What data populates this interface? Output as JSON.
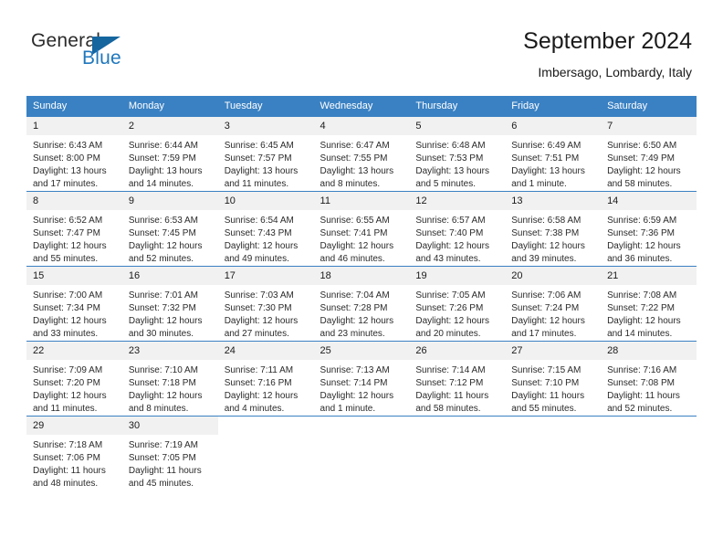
{
  "logo": {
    "word_one": "General",
    "word_two": "Blue",
    "triangle_icon": "triangle-right-icon",
    "brand_color": "#1f77bd",
    "triangle_color": "#15659f"
  },
  "header": {
    "title": "September 2024",
    "subtitle": "Imbersago, Lombardy, Italy",
    "header_bg_color": "#3a81c3",
    "daynum_bg_color": "#f1f1f1"
  },
  "weekday_headers": [
    "Sunday",
    "Monday",
    "Tuesday",
    "Wednesday",
    "Thursday",
    "Friday",
    "Saturday"
  ],
  "weeks": [
    [
      {
        "day": "1",
        "sunrise": "Sunrise: 6:43 AM",
        "sunset": "Sunset: 8:00 PM",
        "daylight_line1": "Daylight: 13 hours",
        "daylight_line2": "and 17 minutes."
      },
      {
        "day": "2",
        "sunrise": "Sunrise: 6:44 AM",
        "sunset": "Sunset: 7:59 PM",
        "daylight_line1": "Daylight: 13 hours",
        "daylight_line2": "and 14 minutes."
      },
      {
        "day": "3",
        "sunrise": "Sunrise: 6:45 AM",
        "sunset": "Sunset: 7:57 PM",
        "daylight_line1": "Daylight: 13 hours",
        "daylight_line2": "and 11 minutes."
      },
      {
        "day": "4",
        "sunrise": "Sunrise: 6:47 AM",
        "sunset": "Sunset: 7:55 PM",
        "daylight_line1": "Daylight: 13 hours",
        "daylight_line2": "and 8 minutes."
      },
      {
        "day": "5",
        "sunrise": "Sunrise: 6:48 AM",
        "sunset": "Sunset: 7:53 PM",
        "daylight_line1": "Daylight: 13 hours",
        "daylight_line2": "and 5 minutes."
      },
      {
        "day": "6",
        "sunrise": "Sunrise: 6:49 AM",
        "sunset": "Sunset: 7:51 PM",
        "daylight_line1": "Daylight: 13 hours",
        "daylight_line2": "and 1 minute."
      },
      {
        "day": "7",
        "sunrise": "Sunrise: 6:50 AM",
        "sunset": "Sunset: 7:49 PM",
        "daylight_line1": "Daylight: 12 hours",
        "daylight_line2": "and 58 minutes."
      }
    ],
    [
      {
        "day": "8",
        "sunrise": "Sunrise: 6:52 AM",
        "sunset": "Sunset: 7:47 PM",
        "daylight_line1": "Daylight: 12 hours",
        "daylight_line2": "and 55 minutes."
      },
      {
        "day": "9",
        "sunrise": "Sunrise: 6:53 AM",
        "sunset": "Sunset: 7:45 PM",
        "daylight_line1": "Daylight: 12 hours",
        "daylight_line2": "and 52 minutes."
      },
      {
        "day": "10",
        "sunrise": "Sunrise: 6:54 AM",
        "sunset": "Sunset: 7:43 PM",
        "daylight_line1": "Daylight: 12 hours",
        "daylight_line2": "and 49 minutes."
      },
      {
        "day": "11",
        "sunrise": "Sunrise: 6:55 AM",
        "sunset": "Sunset: 7:41 PM",
        "daylight_line1": "Daylight: 12 hours",
        "daylight_line2": "and 46 minutes."
      },
      {
        "day": "12",
        "sunrise": "Sunrise: 6:57 AM",
        "sunset": "Sunset: 7:40 PM",
        "daylight_line1": "Daylight: 12 hours",
        "daylight_line2": "and 43 minutes."
      },
      {
        "day": "13",
        "sunrise": "Sunrise: 6:58 AM",
        "sunset": "Sunset: 7:38 PM",
        "daylight_line1": "Daylight: 12 hours",
        "daylight_line2": "and 39 minutes."
      },
      {
        "day": "14",
        "sunrise": "Sunrise: 6:59 AM",
        "sunset": "Sunset: 7:36 PM",
        "daylight_line1": "Daylight: 12 hours",
        "daylight_line2": "and 36 minutes."
      }
    ],
    [
      {
        "day": "15",
        "sunrise": "Sunrise: 7:00 AM",
        "sunset": "Sunset: 7:34 PM",
        "daylight_line1": "Daylight: 12 hours",
        "daylight_line2": "and 33 minutes."
      },
      {
        "day": "16",
        "sunrise": "Sunrise: 7:01 AM",
        "sunset": "Sunset: 7:32 PM",
        "daylight_line1": "Daylight: 12 hours",
        "daylight_line2": "and 30 minutes."
      },
      {
        "day": "17",
        "sunrise": "Sunrise: 7:03 AM",
        "sunset": "Sunset: 7:30 PM",
        "daylight_line1": "Daylight: 12 hours",
        "daylight_line2": "and 27 minutes."
      },
      {
        "day": "18",
        "sunrise": "Sunrise: 7:04 AM",
        "sunset": "Sunset: 7:28 PM",
        "daylight_line1": "Daylight: 12 hours",
        "daylight_line2": "and 23 minutes."
      },
      {
        "day": "19",
        "sunrise": "Sunrise: 7:05 AM",
        "sunset": "Sunset: 7:26 PM",
        "daylight_line1": "Daylight: 12 hours",
        "daylight_line2": "and 20 minutes."
      },
      {
        "day": "20",
        "sunrise": "Sunrise: 7:06 AM",
        "sunset": "Sunset: 7:24 PM",
        "daylight_line1": "Daylight: 12 hours",
        "daylight_line2": "and 17 minutes."
      },
      {
        "day": "21",
        "sunrise": "Sunrise: 7:08 AM",
        "sunset": "Sunset: 7:22 PM",
        "daylight_line1": "Daylight: 12 hours",
        "daylight_line2": "and 14 minutes."
      }
    ],
    [
      {
        "day": "22",
        "sunrise": "Sunrise: 7:09 AM",
        "sunset": "Sunset: 7:20 PM",
        "daylight_line1": "Daylight: 12 hours",
        "daylight_line2": "and 11 minutes."
      },
      {
        "day": "23",
        "sunrise": "Sunrise: 7:10 AM",
        "sunset": "Sunset: 7:18 PM",
        "daylight_line1": "Daylight: 12 hours",
        "daylight_line2": "and 8 minutes."
      },
      {
        "day": "24",
        "sunrise": "Sunrise: 7:11 AM",
        "sunset": "Sunset: 7:16 PM",
        "daylight_line1": "Daylight: 12 hours",
        "daylight_line2": "and 4 minutes."
      },
      {
        "day": "25",
        "sunrise": "Sunrise: 7:13 AM",
        "sunset": "Sunset: 7:14 PM",
        "daylight_line1": "Daylight: 12 hours",
        "daylight_line2": "and 1 minute."
      },
      {
        "day": "26",
        "sunrise": "Sunrise: 7:14 AM",
        "sunset": "Sunset: 7:12 PM",
        "daylight_line1": "Daylight: 11 hours",
        "daylight_line2": "and 58 minutes."
      },
      {
        "day": "27",
        "sunrise": "Sunrise: 7:15 AM",
        "sunset": "Sunset: 7:10 PM",
        "daylight_line1": "Daylight: 11 hours",
        "daylight_line2": "and 55 minutes."
      },
      {
        "day": "28",
        "sunrise": "Sunrise: 7:16 AM",
        "sunset": "Sunset: 7:08 PM",
        "daylight_line1": "Daylight: 11 hours",
        "daylight_line2": "and 52 minutes."
      }
    ],
    [
      {
        "day": "29",
        "sunrise": "Sunrise: 7:18 AM",
        "sunset": "Sunset: 7:06 PM",
        "daylight_line1": "Daylight: 11 hours",
        "daylight_line2": "and 48 minutes."
      },
      {
        "day": "30",
        "sunrise": "Sunrise: 7:19 AM",
        "sunset": "Sunset: 7:05 PM",
        "daylight_line1": "Daylight: 11 hours",
        "daylight_line2": "and 45 minutes."
      },
      {
        "day": "",
        "sunrise": "",
        "sunset": "",
        "daylight_line1": "",
        "daylight_line2": ""
      },
      {
        "day": "",
        "sunrise": "",
        "sunset": "",
        "daylight_line1": "",
        "daylight_line2": ""
      },
      {
        "day": "",
        "sunrise": "",
        "sunset": "",
        "daylight_line1": "",
        "daylight_line2": ""
      },
      {
        "day": "",
        "sunrise": "",
        "sunset": "",
        "daylight_line1": "",
        "daylight_line2": ""
      },
      {
        "day": "",
        "sunrise": "",
        "sunset": "",
        "daylight_line1": "",
        "daylight_line2": ""
      }
    ]
  ]
}
